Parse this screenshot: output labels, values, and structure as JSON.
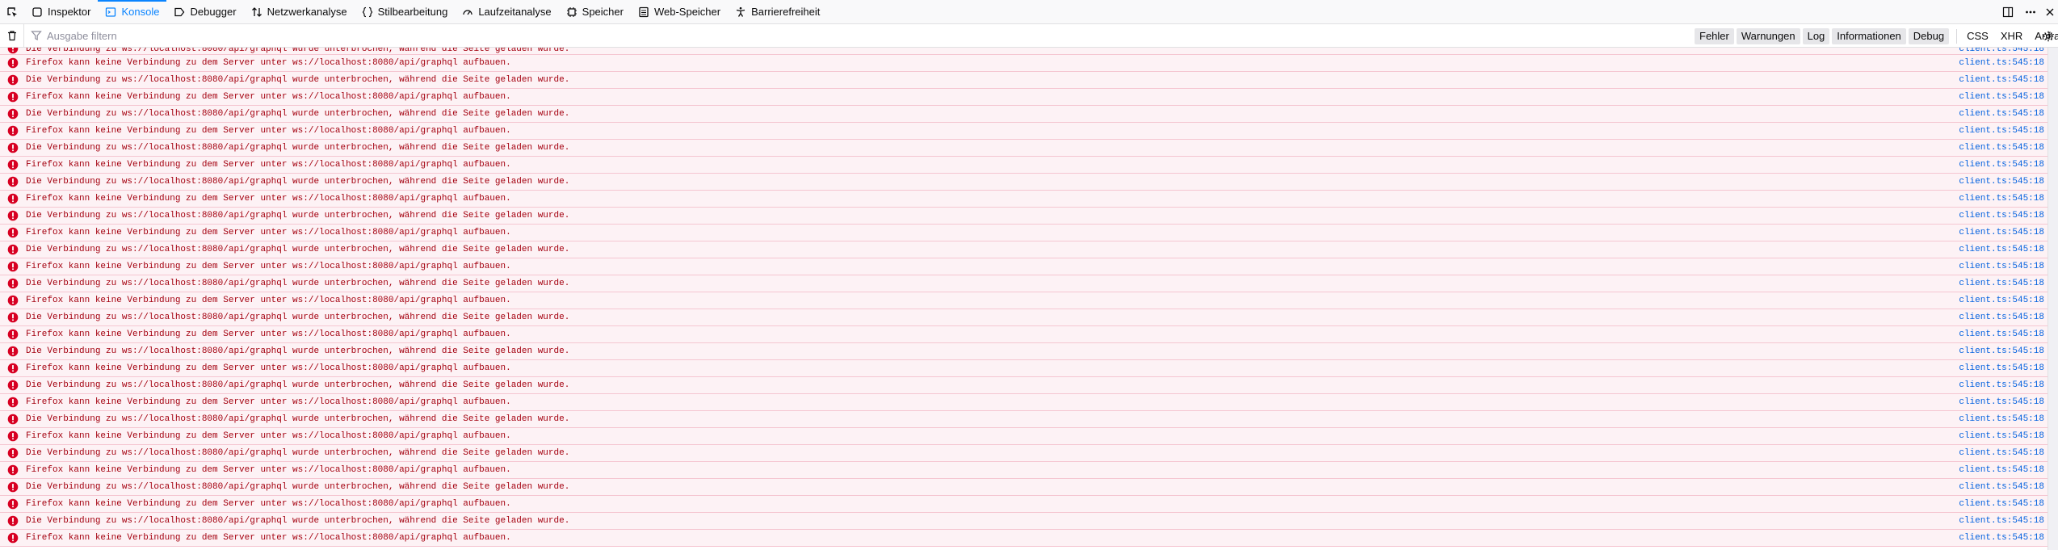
{
  "toolbar": {
    "tabs": [
      {
        "label": "Inspektor",
        "icon": "inspector-icon",
        "active": false
      },
      {
        "label": "Konsole",
        "icon": "console-icon",
        "active": true
      },
      {
        "label": "Debugger",
        "icon": "debugger-icon",
        "active": false
      },
      {
        "label": "Netzwerkanalyse",
        "icon": "network-icon",
        "active": false
      },
      {
        "label": "Stilbearbeitung",
        "icon": "style-editor-icon",
        "active": false
      },
      {
        "label": "Laufzeitanalyse",
        "icon": "performance-icon",
        "active": false
      },
      {
        "label": "Speicher",
        "icon": "memory-icon",
        "active": false
      },
      {
        "label": "Web-Speicher",
        "icon": "storage-icon",
        "active": false
      },
      {
        "label": "Barrierefreiheit",
        "icon": "accessibility-icon",
        "active": false
      }
    ]
  },
  "filter": {
    "placeholder": "Ausgabe filtern",
    "levels": [
      {
        "label": "Fehler",
        "on": true
      },
      {
        "label": "Warnungen",
        "on": true
      },
      {
        "label": "Log",
        "on": true
      },
      {
        "label": "Informationen",
        "on": true
      },
      {
        "label": "Debug",
        "on": true
      }
    ],
    "extras": [
      "CSS",
      "XHR",
      "Anfragen"
    ]
  },
  "log": {
    "partial_message": "Die Verbindung zu ws://localhost:8080/api/graphql wurde unterbrochen, während die Seite geladen wurde.",
    "message_a": "Firefox kann keine Verbindung zu dem Server unter ws://localhost:8080/api/graphql aufbauen.",
    "message_b": "Die Verbindung zu ws://localhost:8080/api/graphql wurde unterbrochen, während die Seite geladen wurde.",
    "source_file": "client.ts",
    "source_line": ":545:18",
    "row_count": 29
  },
  "colors": {
    "accent": "#0a84ff",
    "error_text": "#a4000f",
    "error_bg": "#fdf2f5",
    "error_border": "#f5c6d1",
    "error_icon": "#d70022"
  }
}
